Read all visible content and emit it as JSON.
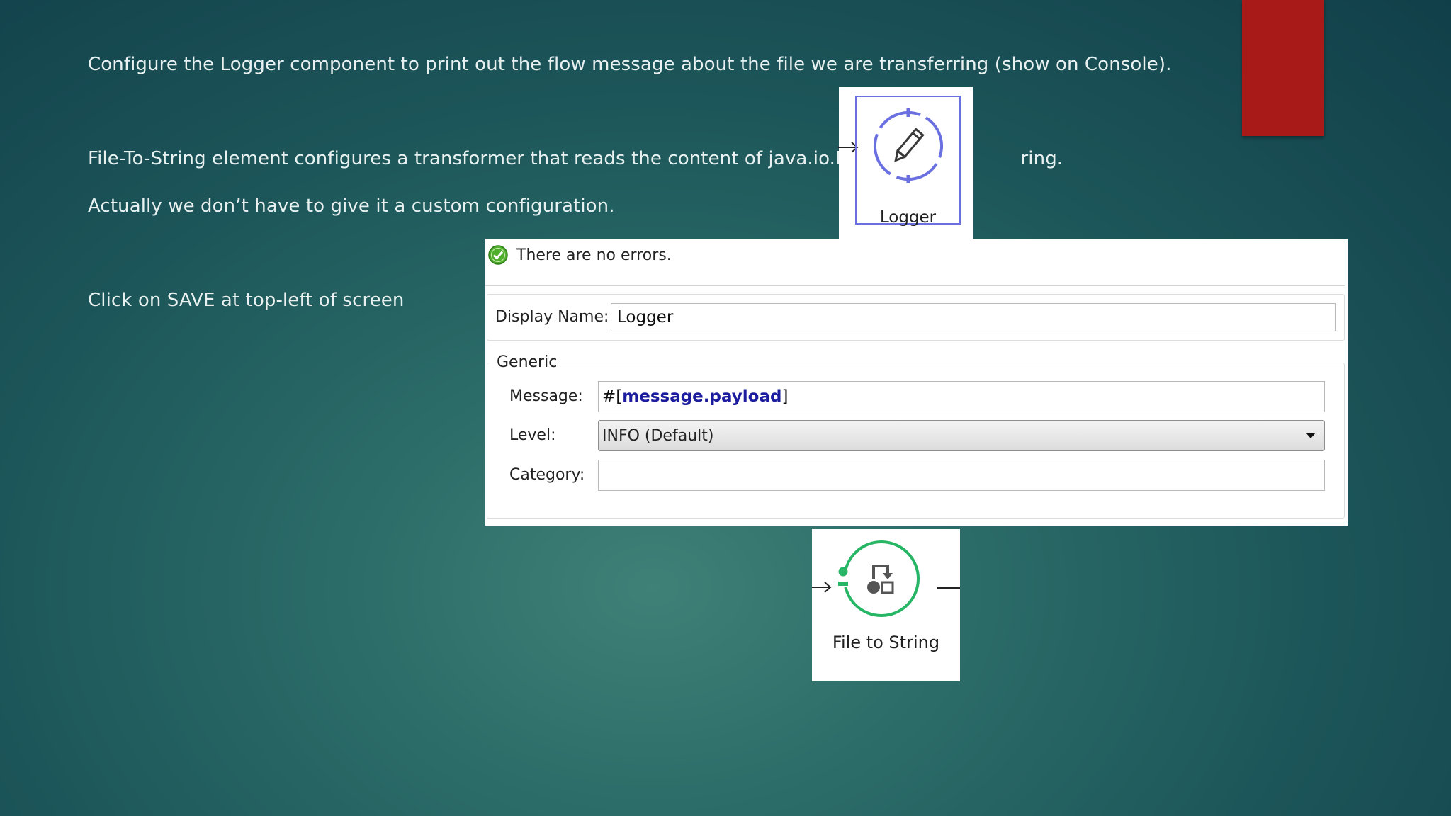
{
  "slide": {
    "line1": "Configure the Logger component to print out the flow message about the file we are transferring (show on Console).",
    "line2a": "File-To-String element configures a transformer that reads the content of java.io.File int",
    "line2b": "ring.",
    "line3": "Actually we don’t have to give it a custom configuration.",
    "line4": "Click on SAVE at top-left of screen"
  },
  "logger_node": {
    "label": "Logger",
    "icon": "pencil-icon",
    "accent_color": "#6b70e0"
  },
  "properties": {
    "status_message": "There are no errors.",
    "status_icon": "check-circle-icon",
    "display_name_label": "Display Name:",
    "display_name_value": "Logger",
    "generic_legend": "Generic",
    "message_label": "Message:",
    "message_prefix": "#[",
    "message_expression": "message.payload",
    "message_suffix": "]",
    "level_label": "Level:",
    "level_value": "INFO (Default)",
    "category_label": "Category:",
    "category_value": ""
  },
  "file_to_string_node": {
    "label": "File to String",
    "icon": "transformer-icon",
    "accent_color": "#27b566"
  },
  "colors": {
    "slide_accent_red": "#a81a18",
    "slide_text": "#e8f1f0"
  }
}
